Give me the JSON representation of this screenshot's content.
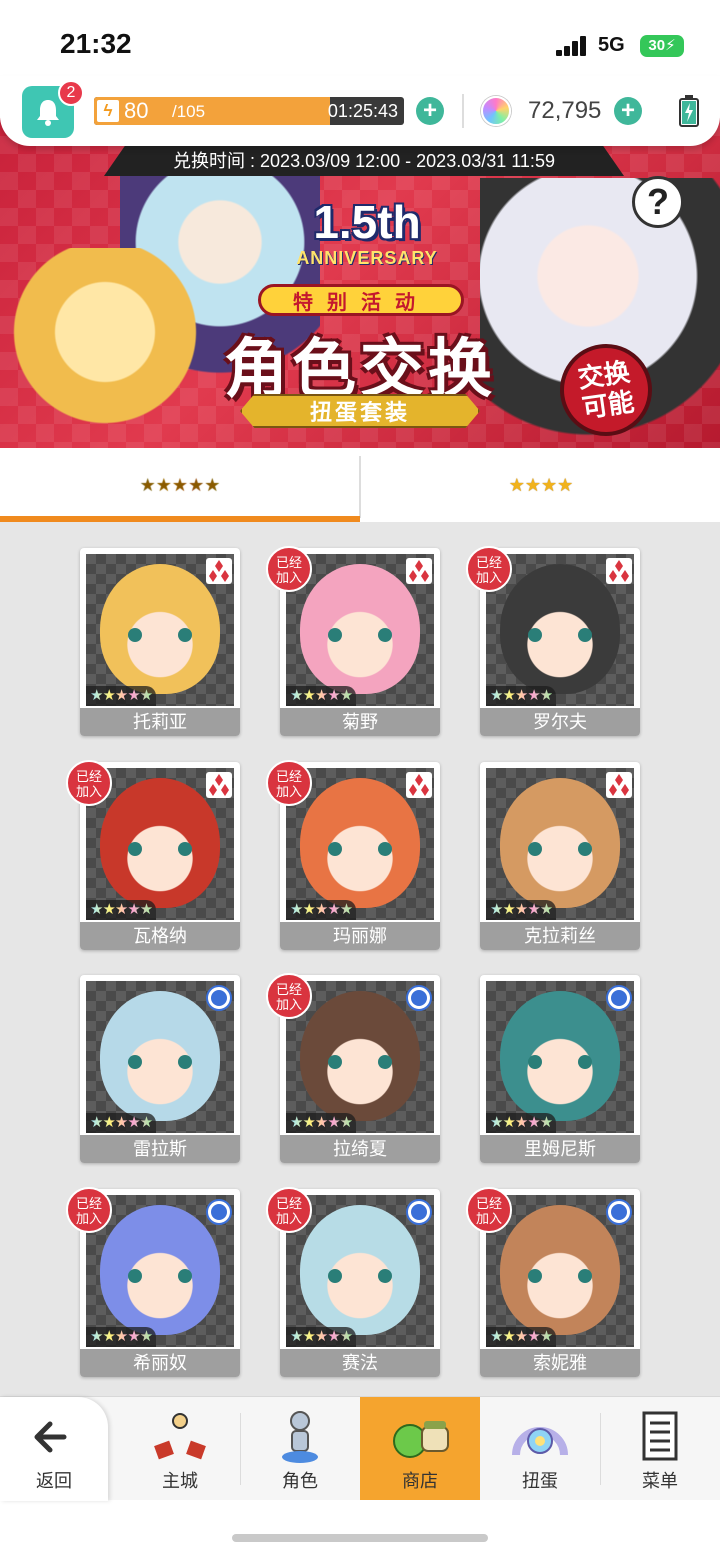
{
  "status_bar": {
    "time": "21:32",
    "network": "5G",
    "battery": "30"
  },
  "top_bar": {
    "notification_count": "2",
    "stamina_current": "80",
    "stamina_max": "/105",
    "stamina_fraction": 0.762,
    "stamina_timer": "01:25:43",
    "gems": "72,795"
  },
  "banner": {
    "exchange_period": "兑换时间 : 2023.03/09 12:00 - 2023.03/31 11:59",
    "anniversary_main": "1.5th",
    "anniversary_sub": "ANNIVERSARY",
    "event_tag": "特别活动",
    "event_title": "角色交换",
    "event_subtitle": "扭蛋套装",
    "stamp_text": "交换可能",
    "help": "?"
  },
  "tabs": [
    {
      "label": "★★★★★",
      "rarity": 5,
      "active": true
    },
    {
      "label": "★★★★",
      "rarity": 4,
      "active": false
    }
  ],
  "owned_label": "已经加入",
  "characters": [
    {
      "name": "托莉亚",
      "stars": "★★★★★",
      "element": "diamond",
      "owned": false,
      "tint": "#f1c15a"
    },
    {
      "name": "菊野",
      "stars": "★★★★★",
      "element": "diamond",
      "owned": true,
      "tint": "#f4a4bf"
    },
    {
      "name": "罗尔夫",
      "stars": "★★★★★",
      "element": "diamond",
      "owned": true,
      "tint": "#3b3b3b"
    },
    {
      "name": "瓦格纳",
      "stars": "★★★★★",
      "element": "diamond",
      "owned": true,
      "tint": "#c8382a"
    },
    {
      "name": "玛丽娜",
      "stars": "★★★★★",
      "element": "diamond",
      "owned": true,
      "tint": "#e87444"
    },
    {
      "name": "克拉莉丝",
      "stars": "★★★★★",
      "element": "diamond",
      "owned": false,
      "tint": "#d59a62"
    },
    {
      "name": "雷拉斯",
      "stars": "★★★★★",
      "element": "circle",
      "owned": false,
      "tint": "#b6d9e8"
    },
    {
      "name": "拉绮夏",
      "stars": "★★★★★",
      "element": "circle",
      "owned": true,
      "tint": "#6b4a3a"
    },
    {
      "name": "里姆尼斯",
      "stars": "★★★★★",
      "element": "circle",
      "owned": false,
      "tint": "#3c8f8e"
    },
    {
      "name": "希丽奴",
      "stars": "★★★★★",
      "element": "circle",
      "owned": true,
      "tint": "#7d8ee8"
    },
    {
      "name": "赛法",
      "stars": "★★★★★",
      "element": "circle",
      "owned": true,
      "tint": "#b7dce6"
    },
    {
      "name": "索妮雅",
      "stars": "★★★★★",
      "element": "circle",
      "owned": true,
      "tint": "#c2845a"
    }
  ],
  "bottom_nav": {
    "back": "返回",
    "town": "主城",
    "characters": "角色",
    "shop": "商店",
    "gacha": "扭蛋",
    "menu": "菜单"
  },
  "colors": {
    "accent": "#f08a1e",
    "teal": "#3fc6b3",
    "banner_red": "#c8213a",
    "owned_badge": "#d9343f"
  }
}
